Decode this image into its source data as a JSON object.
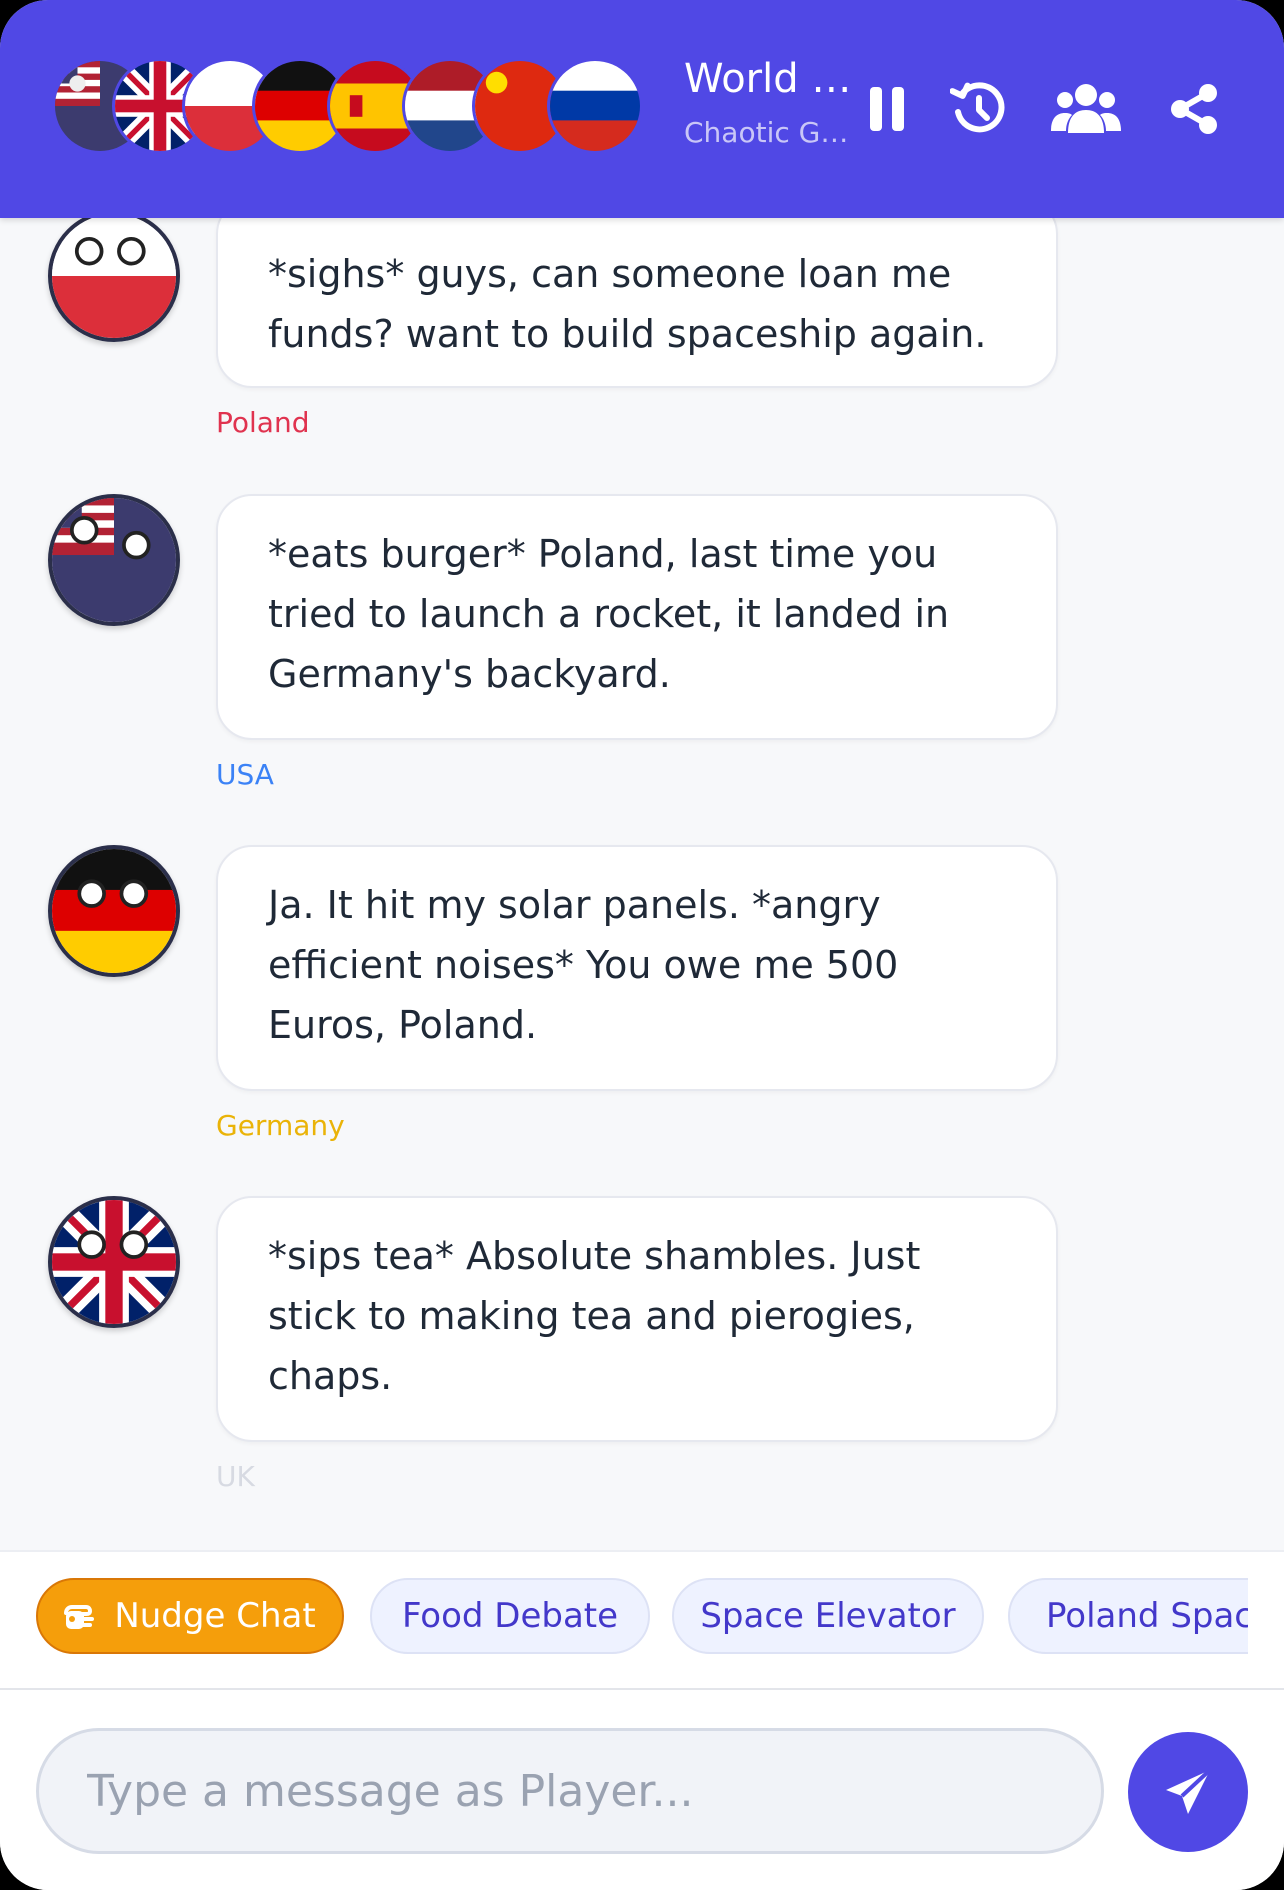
{
  "header": {
    "title": "World Chat",
    "subtitle": "Chaotic Group",
    "participants": [
      "USA",
      "UK",
      "Poland",
      "Germany",
      "Spain",
      "Netherlands",
      "China",
      "Russia"
    ],
    "icons": {
      "pause": "pause-icon",
      "history": "history-icon",
      "members": "members-icon",
      "share": "share-icon"
    }
  },
  "messages": [
    {
      "sender": "Poland",
      "color": "#e0334f",
      "text": "*sighs* guys, can someone loan me funds? want to build spaceship again."
    },
    {
      "sender": "USA",
      "color": "#3b82f6",
      "text": "*eats burger* Poland, last time you tried to launch a rocket, it landed in Germany's backyard."
    },
    {
      "sender": "Germany",
      "color": "#eab308",
      "text": "Ja. It hit my solar panels. *angry efficient noises* You owe me 500 Euros, Poland."
    },
    {
      "sender": "UK",
      "color": "#d7dae2",
      "text": "*sips tea* Absolute shambles. Just stick to making tea and pierogies, chaps."
    }
  ],
  "chips": {
    "nudge": {
      "label": "Nudge Chat",
      "icon": "hand-point-icon"
    },
    "suggestions": [
      "Food Debate",
      "Space Elevator",
      "Poland Space"
    ]
  },
  "composer": {
    "placeholder": "Type a message as Player...",
    "value": "",
    "send_icon": "paper-plane-icon"
  },
  "colors": {
    "header": "#5048e5",
    "accent": "#5048e5",
    "nudge": "#f59e0b"
  }
}
